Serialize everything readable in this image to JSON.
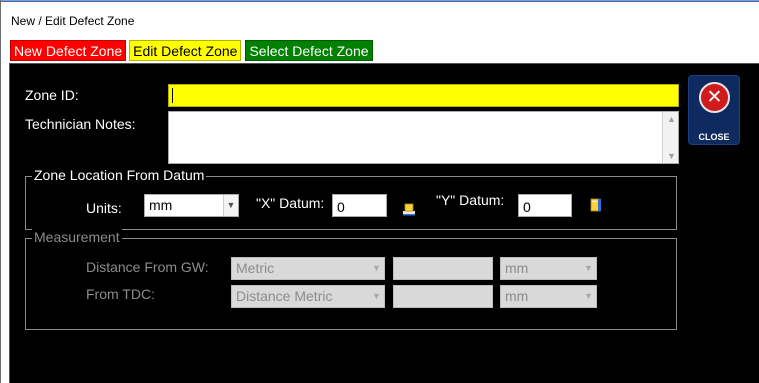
{
  "window": {
    "title": "New / Edit Defect Zone"
  },
  "tabs": [
    {
      "label": "New Defect Zone"
    },
    {
      "label": "Edit Defect Zone"
    },
    {
      "label": "Select Defect Zone"
    }
  ],
  "form": {
    "zone_id_label": "Zone ID:",
    "zone_id_value": "",
    "technician_notes_label": "Technician Notes:",
    "technician_notes_value": ""
  },
  "close_button": {
    "label": "CLOSE",
    "icon": "close-x-icon"
  },
  "zone_location": {
    "title": "Zone Location From Datum",
    "units_label": "Units:",
    "units_value": "mm",
    "x_datum_label": "\"X\" Datum:",
    "x_datum_value": "0",
    "y_datum_label": "\"Y\" Datum:",
    "y_datum_value": "0"
  },
  "measurement": {
    "title": "Measurement",
    "distance_from_gw_label": "Distance From GW:",
    "distance_from_gw_type": "Metric",
    "distance_from_gw_value": "",
    "distance_from_gw_unit": "mm",
    "from_tdc_label": "From TDC:",
    "from_tdc_type": "Distance Metric",
    "from_tdc_value": "",
    "from_tdc_unit": "mm"
  },
  "colors": {
    "tab_new": "#ff0000",
    "tab_edit": "#ffff00",
    "tab_select": "#008000",
    "panel_bg": "#000000",
    "zone_id_bg": "#ffff00",
    "close_button_bg": "#0f2a5e",
    "close_icon": "#cf1b1b"
  }
}
